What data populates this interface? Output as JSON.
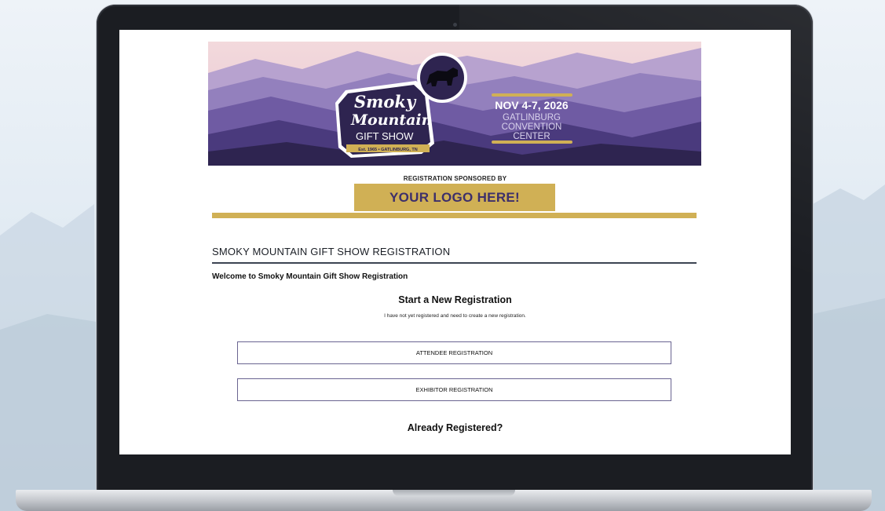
{
  "banner": {
    "logo_line1": "Smoky",
    "logo_line2": "Mountain",
    "logo_line3": "GIFT SHOW",
    "logo_tagline": "Est. 1965 • GATLINBURG, TN",
    "event_dates": "NOV 4-7, 2026",
    "venue_line1": "GATLINBURG",
    "venue_line2": "CONVENTION",
    "venue_line3": "CENTER"
  },
  "sponsor": {
    "label": "REGISTRATION SPONSORED BY",
    "logo_text": "YOUR LOGO HERE!"
  },
  "page": {
    "title": "SMOKY MOUNTAIN GIFT SHOW REGISTRATION",
    "welcome": "Welcome to Smoky Mountain Gift Show Registration"
  },
  "new_registration": {
    "heading": "Start a New Registration",
    "subtext": "I have not yet registered and need to create a new registration.",
    "attendee_button": "ATTENDEE REGISTRATION",
    "exhibitor_button": "EXHIBITOR REGISTRATION"
  },
  "existing_registration": {
    "heading": "Already Registered?"
  },
  "colors": {
    "gold": "#d0b055",
    "purple_dark": "#2e2450",
    "button_border": "#6a6491"
  }
}
